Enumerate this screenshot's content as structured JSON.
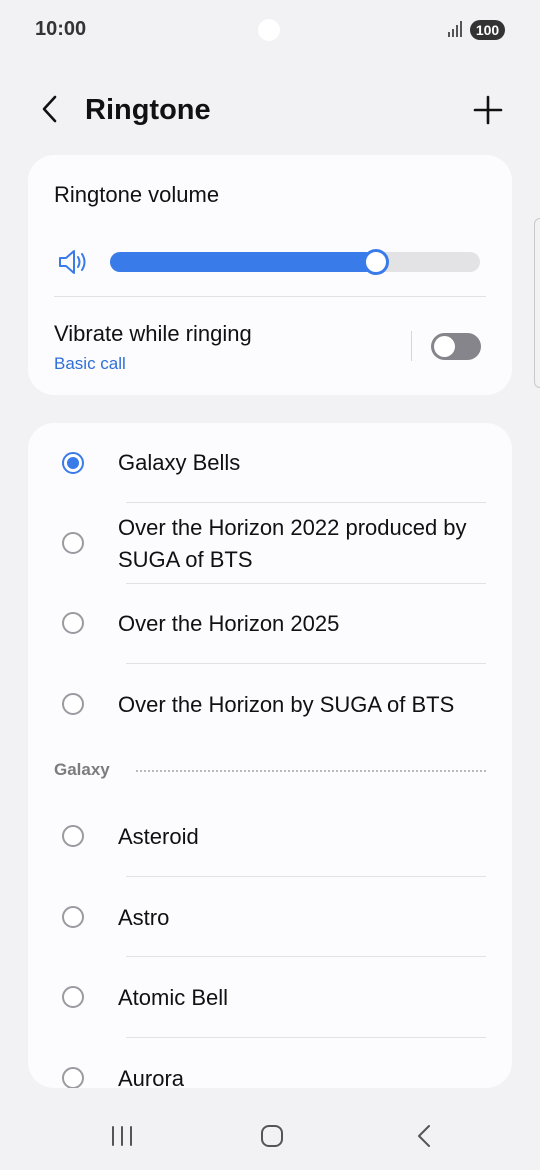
{
  "status_bar": {
    "time": "10:00",
    "battery": "100"
  },
  "header": {
    "title": "Ringtone"
  },
  "volume": {
    "label": "Ringtone volume",
    "level_percent": 72
  },
  "vibrate": {
    "label": "Vibrate while ringing",
    "sub": "Basic call",
    "enabled": false
  },
  "ringtones": {
    "top_items": [
      {
        "label": "Galaxy Bells",
        "selected": true
      },
      {
        "label": "Over the Horizon 2022 produced by SUGA of BTS",
        "selected": false
      },
      {
        "label": "Over the Horizon 2025",
        "selected": false
      },
      {
        "label": "Over the Horizon by SUGA of BTS",
        "selected": false
      }
    ],
    "section": "Galaxy",
    "galaxy_items": [
      {
        "label": "Asteroid",
        "selected": false
      },
      {
        "label": "Astro",
        "selected": false
      },
      {
        "label": "Atomic Bell",
        "selected": false
      },
      {
        "label": "Aurora",
        "selected": false
      }
    ]
  },
  "colors": {
    "accent": "#3a7bea",
    "link": "#2f6fd8",
    "background": "#f2f2f4",
    "card": "#fcfcfe"
  },
  "icons": {
    "back": "chevron-left-icon",
    "add": "plus-icon",
    "volume": "speaker-icon"
  }
}
